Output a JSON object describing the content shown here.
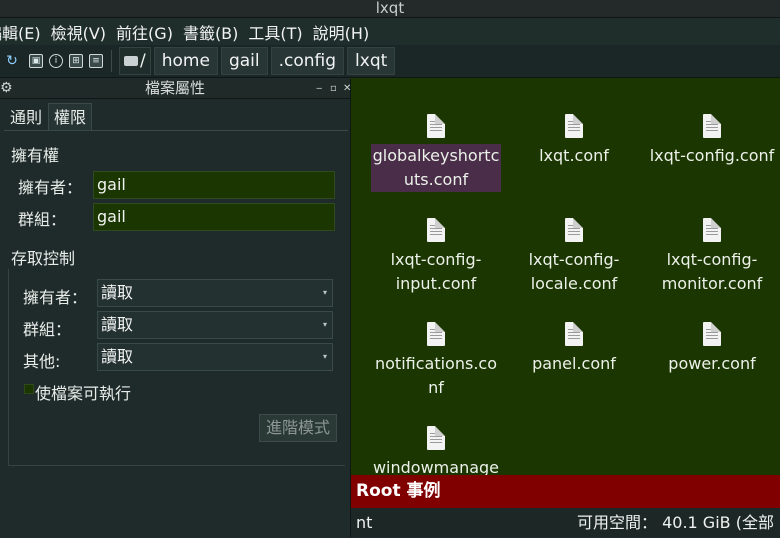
{
  "window": {
    "title": "lxqt"
  },
  "menubar": {
    "items": [
      "編輯(E)",
      "檢視(V)",
      "前往(G)",
      "書籤(B)",
      "工具(T)",
      "說明(H)"
    ]
  },
  "toolbar": {
    "icons": [
      "reload-icon",
      "new-window-icon",
      "info-icon",
      "icon-view-icon",
      "list-view-icon"
    ],
    "breadcrumb": [
      "/",
      "home",
      "gail",
      ".config",
      "lxqt"
    ]
  },
  "dialog": {
    "title": "檔案屬性",
    "tabs": [
      "通則",
      "權限"
    ],
    "active_tab": "權限",
    "ownership": {
      "heading": "擁有權",
      "owner_label": "擁有者：",
      "owner_value": "gail",
      "group_label": "群組：",
      "group_value": "gail"
    },
    "access": {
      "heading": "存取控制",
      "rows": [
        {
          "label": "擁有者：",
          "value": "讀取"
        },
        {
          "label": "群組：",
          "value": "讀取"
        },
        {
          "label": "其他:",
          "value": "讀取"
        }
      ],
      "executable_label": "使檔案可執行",
      "advanced_button": "進階模式"
    }
  },
  "files": [
    {
      "name": "globalkeyshortcuts.conf",
      "line1": "globalkeyshortc",
      "line2": "uts.conf",
      "selected": true
    },
    {
      "name": "lxqt.conf",
      "line1": "lxqt.conf",
      "line2": ""
    },
    {
      "name": "lxqt-config.conf",
      "line1": "lxqt-config.conf",
      "line2": ""
    },
    {
      "name": "lxqt-config-input.conf",
      "line1": "lxqt-config-",
      "line2": "input.conf"
    },
    {
      "name": "lxqt-config-locale.conf",
      "line1": "lxqt-config-",
      "line2": "locale.conf"
    },
    {
      "name": "lxqt-config-monitor.conf",
      "line1": "lxqt-config-",
      "line2": "monitor.conf"
    },
    {
      "name": "notifications.conf",
      "line1": "notifications.co",
      "line2": "nf"
    },
    {
      "name": "panel.conf",
      "line1": "panel.conf",
      "line2": ""
    },
    {
      "name": "power.conf",
      "line1": "power.conf",
      "line2": ""
    },
    {
      "name": "windowmanage",
      "line1": "windowmanage",
      "line2": ""
    }
  ],
  "rootbar": {
    "text": "Root 事例"
  },
  "status": {
    "left": "nt",
    "right": "可用空間： 40.1 GiB (全部"
  },
  "colors": {
    "root_bar": "#800000",
    "file_bg": "#1b3600",
    "selection": "#4a2d48"
  }
}
